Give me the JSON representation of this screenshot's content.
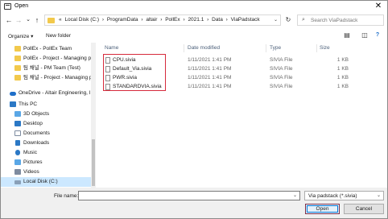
{
  "window": {
    "title": "Open",
    "close_glyph": "✕"
  },
  "nav_buttons": {
    "back": "←",
    "forward": "→",
    "recent": "⌄",
    "up": "↑"
  },
  "address": {
    "crumbs": [
      "«",
      "Local Disk (C:)",
      "›",
      "ProgramData",
      "›",
      "altair",
      "›",
      "PollEx",
      "›",
      "2021.1",
      "›",
      "Data",
      "›",
      "ViaPadstack"
    ],
    "dropdown": "⌄",
    "refresh": "↻"
  },
  "search": {
    "placeholder": "Search ViaPadstack",
    "icon": "⌕"
  },
  "toolbar": {
    "organize": "Organize ▾",
    "new_folder": "New folder",
    "view_icon": "▤",
    "pane_icon": "◫",
    "help_icon": "?"
  },
  "nav_pane": {
    "items": [
      {
        "label": "PollEx - PollEx Team",
        "icon": "folder-icon",
        "color": "#f2c94c"
      },
      {
        "label": "PollEx - Project - Managing p",
        "icon": "folder-icon",
        "color": "#f2c94c"
      },
      {
        "label": "팀 채널 - PM Team (Test)",
        "icon": "folder-icon",
        "color": "#f2c94c"
      },
      {
        "label": "팀 채널 - Project - Managing pa",
        "icon": "folder-icon",
        "color": "#f2c94c"
      },
      {
        "label": "",
        "icon": "",
        "color": ""
      },
      {
        "label": "OneDrive - Altair Engineering, In",
        "icon": "cloud-icon",
        "color": "#1f6fc9"
      },
      {
        "label": "This PC",
        "icon": "computer-icon",
        "color": "#2b78c5"
      },
      {
        "label": "3D Objects",
        "icon": "cube-icon",
        "color": "#5aa7e6"
      },
      {
        "label": "Desktop",
        "icon": "desktop-icon",
        "color": "#2b78c5"
      },
      {
        "label": "Documents",
        "icon": "documents-icon",
        "color": "#7d8ba0"
      },
      {
        "label": "Downloads",
        "icon": "download-icon",
        "color": "#2b78c5"
      },
      {
        "label": "Music",
        "icon": "music-icon",
        "color": "#2b78c5"
      },
      {
        "label": "Pictures",
        "icon": "pictures-icon",
        "color": "#5aa7e6"
      },
      {
        "label": "Videos",
        "icon": "videos-icon",
        "color": "#7d8ba0"
      },
      {
        "label": "Local Disk (C:)",
        "icon": "drive-icon",
        "color": "#8aa0b8"
      }
    ]
  },
  "columns": {
    "name": "Name",
    "date": "Date modified",
    "type": "Type",
    "size": "Size"
  },
  "files": [
    {
      "name": "CPU.sivia",
      "date": "1/11/2021 1:41 PM",
      "type": "SIVIA File",
      "size": "1 KB"
    },
    {
      "name": "Default_Via.sivia",
      "date": "1/11/2021 1:41 PM",
      "type": "SIVIA File",
      "size": "1 KB"
    },
    {
      "name": "PWR.sivia",
      "date": "1/11/2021 1:41 PM",
      "type": "SIVIA File",
      "size": "1 KB"
    },
    {
      "name": "STANDARDVIA.sivia",
      "date": "1/11/2021 1:41 PM",
      "type": "SIVIA File",
      "size": "1 KB"
    }
  ],
  "bottom": {
    "file_name_label": "File name:",
    "file_name_value": "",
    "file_type": "Via padstack (*.sivia)",
    "open_label": "Open",
    "cancel_label": "Cancel",
    "dropdown": "⌄"
  },
  "colors": {
    "highlight": "#d62b3c",
    "selection": "#cce8ff",
    "accent": "#0078d7"
  }
}
